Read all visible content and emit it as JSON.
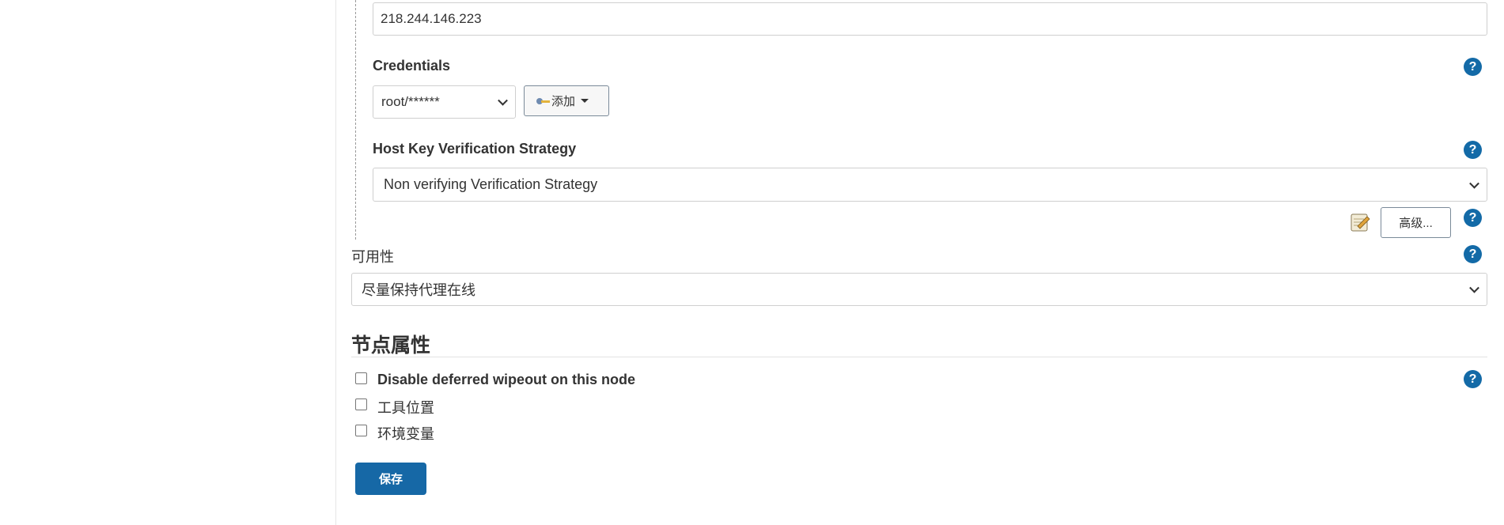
{
  "host": {
    "value": "218.244.146.223"
  },
  "credentials": {
    "label": "Credentials",
    "selected": "root/******",
    "add_label": "添加"
  },
  "host_key": {
    "label": "Host Key Verification Strategy",
    "selected": "Non verifying Verification Strategy"
  },
  "advanced": {
    "label": "高级..."
  },
  "availability": {
    "label": "可用性",
    "selected": "尽量保持代理在线"
  },
  "node_properties": {
    "title": "节点属性",
    "items": [
      {
        "label": "Disable deferred wipeout on this node",
        "checked": false
      },
      {
        "label": "工具位置",
        "checked": false
      },
      {
        "label": "环境变量",
        "checked": false
      }
    ]
  },
  "help_glyph": "?",
  "save_label": "保存",
  "icons": {
    "help": "help-icon",
    "key": "key-icon",
    "notepad": "notepad-icon",
    "caret": "caret-down-icon"
  },
  "colors": {
    "primary": "#1668a6",
    "help": "#136aa7"
  }
}
